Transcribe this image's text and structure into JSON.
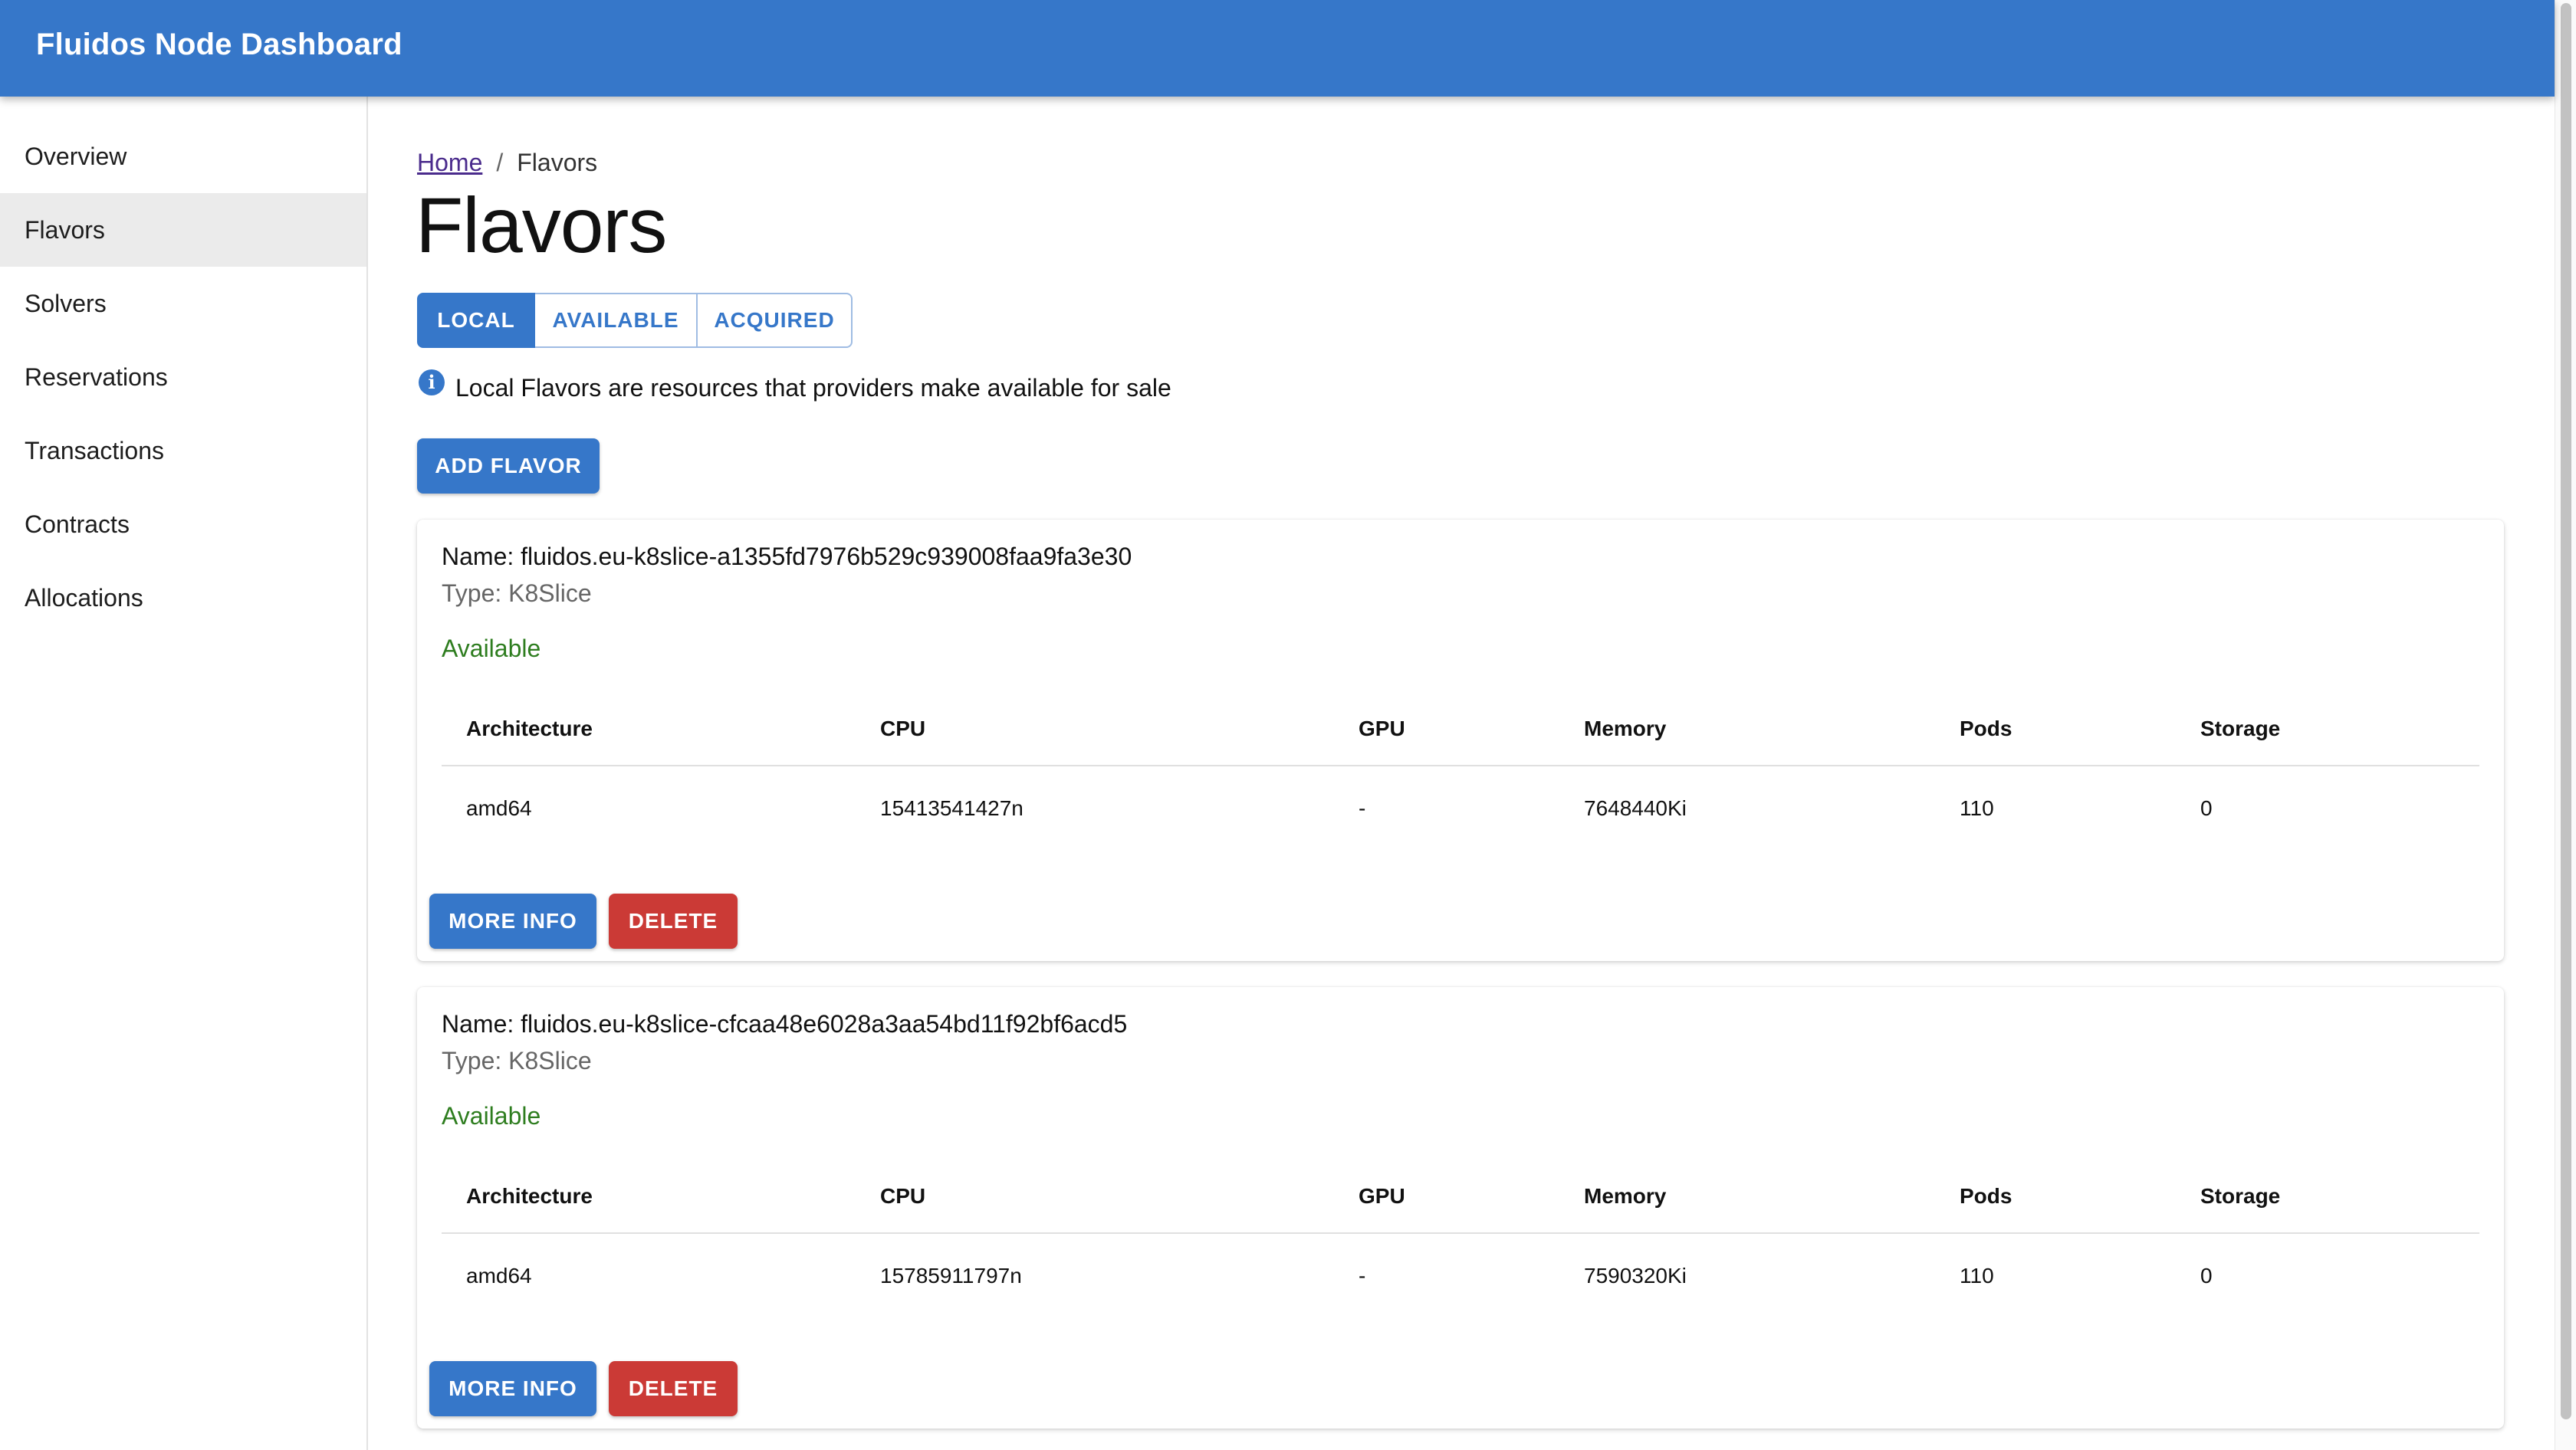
{
  "app": {
    "title": "Fluidos Node Dashboard"
  },
  "sidebar": {
    "items": [
      {
        "label": "Overview"
      },
      {
        "label": "Flavors",
        "active": true
      },
      {
        "label": "Solvers"
      },
      {
        "label": "Reservations"
      },
      {
        "label": "Transactions"
      },
      {
        "label": "Contracts"
      },
      {
        "label": "Allocations"
      }
    ]
  },
  "breadcrumb": {
    "home": "Home",
    "separator": "/",
    "current": "Flavors"
  },
  "page": {
    "title": "Flavors"
  },
  "tabs": [
    {
      "label": "LOCAL",
      "active": true
    },
    {
      "label": "AVAILABLE",
      "active": false
    },
    {
      "label": "ACQUIRED",
      "active": false
    }
  ],
  "info": {
    "icon": "info-icon",
    "icon_glyph": "i",
    "text": "Local Flavors are resources that providers make available for sale"
  },
  "actions": {
    "add_flavor": "ADD FLAVOR"
  },
  "table_headers": [
    "Architecture",
    "CPU",
    "GPU",
    "Memory",
    "Pods",
    "Storage"
  ],
  "flavors": [
    {
      "name": "Name: fluidos.eu-k8slice-a1355fd7976b529c939008faa9fa3e30",
      "type": "Type: K8Slice",
      "status": "Available",
      "row": [
        "amd64",
        "15413541427n",
        "-",
        "7648440Ki",
        "110",
        "0"
      ],
      "more_info": "MORE INFO",
      "delete": "DELETE"
    },
    {
      "name": "Name: fluidos.eu-k8slice-cfcaa48e6028a3aa54bd11f92bf6acd5",
      "type": "Type: K8Slice",
      "status": "Available",
      "row": [
        "amd64",
        "15785911797n",
        "-",
        "7590320Ki",
        "110",
        "0"
      ],
      "more_info": "MORE INFO",
      "delete": "DELETE"
    }
  ],
  "colors": {
    "primary": "#3677c9",
    "danger": "#cb3a36",
    "success": "#2e7d1f",
    "active_nav": "#ebebeb"
  }
}
